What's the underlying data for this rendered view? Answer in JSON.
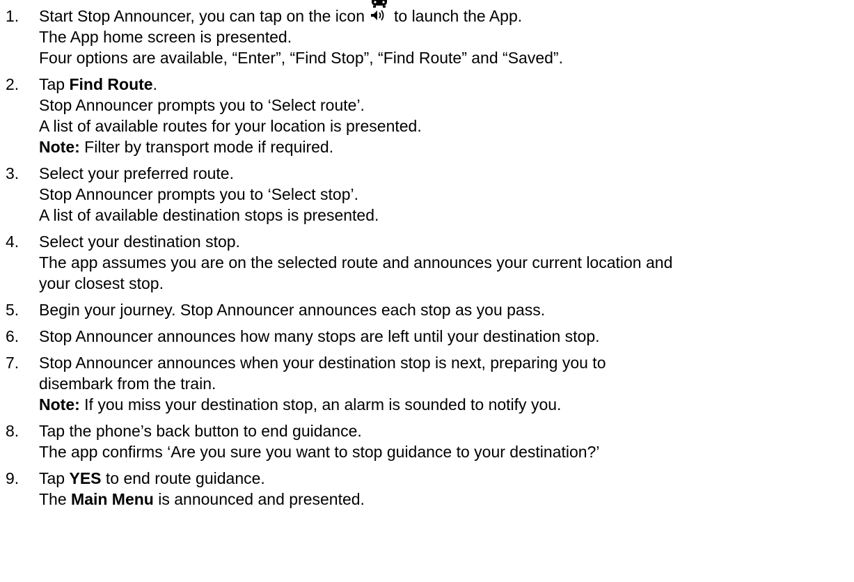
{
  "icons": {
    "app_icon": "bus-speaker-icon"
  },
  "steps": [
    {
      "num": "1.",
      "l1_before": "Start Stop Announcer, you can tap on the icon",
      "l1_after": "to launch the App.",
      "l2": "The App home screen is presented.",
      "l3": "Four options are available, “Enter”, “Find Stop”, “Find Route” and “Saved”."
    },
    {
      "num": "2.",
      "l1_pre": "Tap ",
      "l1_bold": "Find Route",
      "l1_post": ".",
      "l2": "Stop Announcer prompts you to ‘Select route’.",
      "l3": "A list of available routes for your location is presented.",
      "l4_bold": "Note:",
      "l4_rest": " Filter by transport mode if required."
    },
    {
      "num": "3.",
      "l1": "Select your preferred route.",
      "l2": "Stop Announcer prompts you to ‘Select stop’.",
      "l3": "A list of available destination stops is presented."
    },
    {
      "num": "4.",
      "l1": "Select your destination stop.",
      "l2": "The app assumes you are on the selected route and announces your current location and",
      "l3": "your closest stop."
    },
    {
      "num": "5.",
      "l1": "Begin your journey. Stop Announcer announces each stop as you pass."
    },
    {
      "num": "6.",
      "l1": "Stop Announcer announces how many stops are left until your destination stop."
    },
    {
      "num": "7.",
      "l1": "Stop Announcer announces when your destination stop is next, preparing you to",
      "l2": "disembark from the train.",
      "l3_bold": "Note:",
      "l3_rest": " If you miss your destination stop, an alarm is sounded to notify you."
    },
    {
      "num": "8.",
      "l1": "Tap the phone’s back button to end guidance.",
      "l2": "The app confirms ‘Are you sure you want to stop guidance to your destination?’"
    },
    {
      "num": "9.",
      "l1_pre": "Tap ",
      "l1_bold": "YES",
      "l1_post": " to end route guidance.",
      "l2_pre": "The ",
      "l2_bold": "Main Menu",
      "l2_post": " is announced and presented."
    }
  ]
}
